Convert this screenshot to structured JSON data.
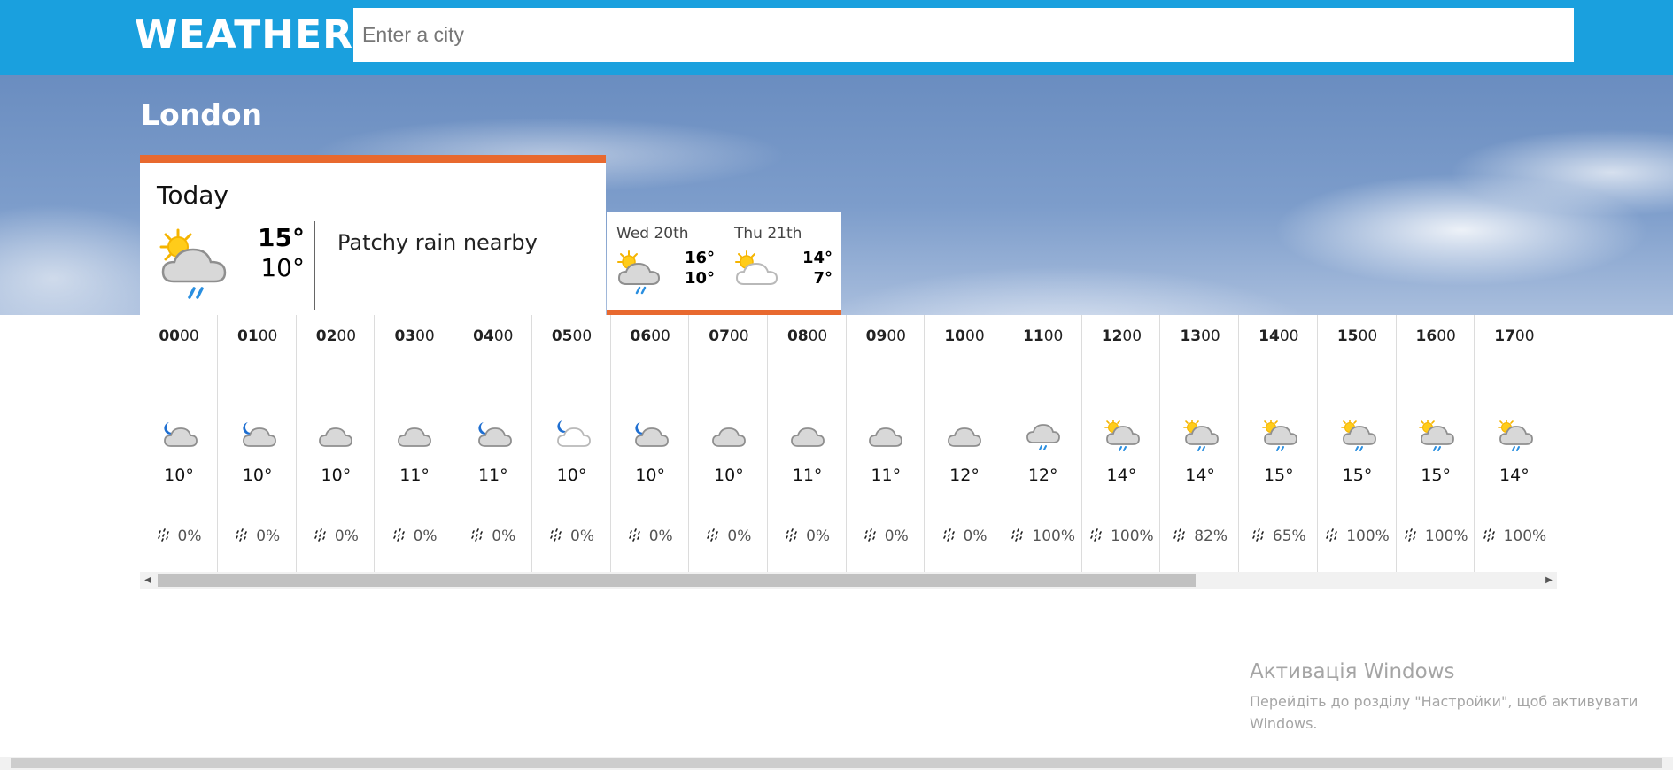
{
  "header": {
    "logo": "WEATHER",
    "search_placeholder": "Enter a city",
    "search_value": ""
  },
  "colors": {
    "header_bg": "#1aa0de",
    "accent": "#e8692f"
  },
  "location": {
    "city": "London"
  },
  "today": {
    "label": "Today",
    "high": "15°",
    "low": "10°",
    "description": "Patchy rain nearby",
    "icon": "sun-cloud-rain-icon"
  },
  "days": [
    {
      "name": "Wed 20th",
      "high": "16°",
      "low": "10°",
      "icon": "sun-cloud-rain-icon"
    },
    {
      "name": "Thu 21th",
      "high": "14°",
      "low": "7°",
      "icon": "sun-cloud-icon"
    }
  ],
  "hours": [
    {
      "hh": "00",
      "mm": "00",
      "temp": "10°",
      "rain": "0%",
      "icon": "moon-cloud-icon"
    },
    {
      "hh": "01",
      "mm": "00",
      "temp": "10°",
      "rain": "0%",
      "icon": "moon-cloud-icon"
    },
    {
      "hh": "02",
      "mm": "00",
      "temp": "10°",
      "rain": "0%",
      "icon": "cloud-icon"
    },
    {
      "hh": "03",
      "mm": "00",
      "temp": "11°",
      "rain": "0%",
      "icon": "cloud-icon"
    },
    {
      "hh": "04",
      "mm": "00",
      "temp": "11°",
      "rain": "0%",
      "icon": "moon-cloud-icon"
    },
    {
      "hh": "05",
      "mm": "00",
      "temp": "10°",
      "rain": "0%",
      "icon": "moon-light-cloud-icon"
    },
    {
      "hh": "06",
      "mm": "00",
      "temp": "10°",
      "rain": "0%",
      "icon": "moon-cloud-icon"
    },
    {
      "hh": "07",
      "mm": "00",
      "temp": "10°",
      "rain": "0%",
      "icon": "cloud-icon"
    },
    {
      "hh": "08",
      "mm": "00",
      "temp": "11°",
      "rain": "0%",
      "icon": "cloud-icon"
    },
    {
      "hh": "09",
      "mm": "00",
      "temp": "11°",
      "rain": "0%",
      "icon": "cloud-icon"
    },
    {
      "hh": "10",
      "mm": "00",
      "temp": "12°",
      "rain": "0%",
      "icon": "cloud-icon"
    },
    {
      "hh": "11",
      "mm": "00",
      "temp": "12°",
      "rain": "100%",
      "icon": "cloud-rain-icon"
    },
    {
      "hh": "12",
      "mm": "00",
      "temp": "14°",
      "rain": "100%",
      "icon": "sun-cloud-rain-icon"
    },
    {
      "hh": "13",
      "mm": "00",
      "temp": "14°",
      "rain": "82%",
      "icon": "sun-cloud-rain-icon"
    },
    {
      "hh": "14",
      "mm": "00",
      "temp": "15°",
      "rain": "65%",
      "icon": "sun-cloud-rain-icon"
    },
    {
      "hh": "15",
      "mm": "00",
      "temp": "15°",
      "rain": "100%",
      "icon": "sun-cloud-rain-icon"
    },
    {
      "hh": "16",
      "mm": "00",
      "temp": "15°",
      "rain": "100%",
      "icon": "sun-cloud-rain-icon"
    },
    {
      "hh": "17",
      "mm": "00",
      "temp": "14°",
      "rain": "100%",
      "icon": "sun-cloud-rain-icon"
    }
  ],
  "hourly_scroll": {
    "left_arrow": "◀",
    "right_arrow": "▶"
  },
  "watermark": {
    "title": "Активація Windows",
    "subtitle": "Перейдіть до розділу \"Настройки\", щоб активувати Windows."
  }
}
